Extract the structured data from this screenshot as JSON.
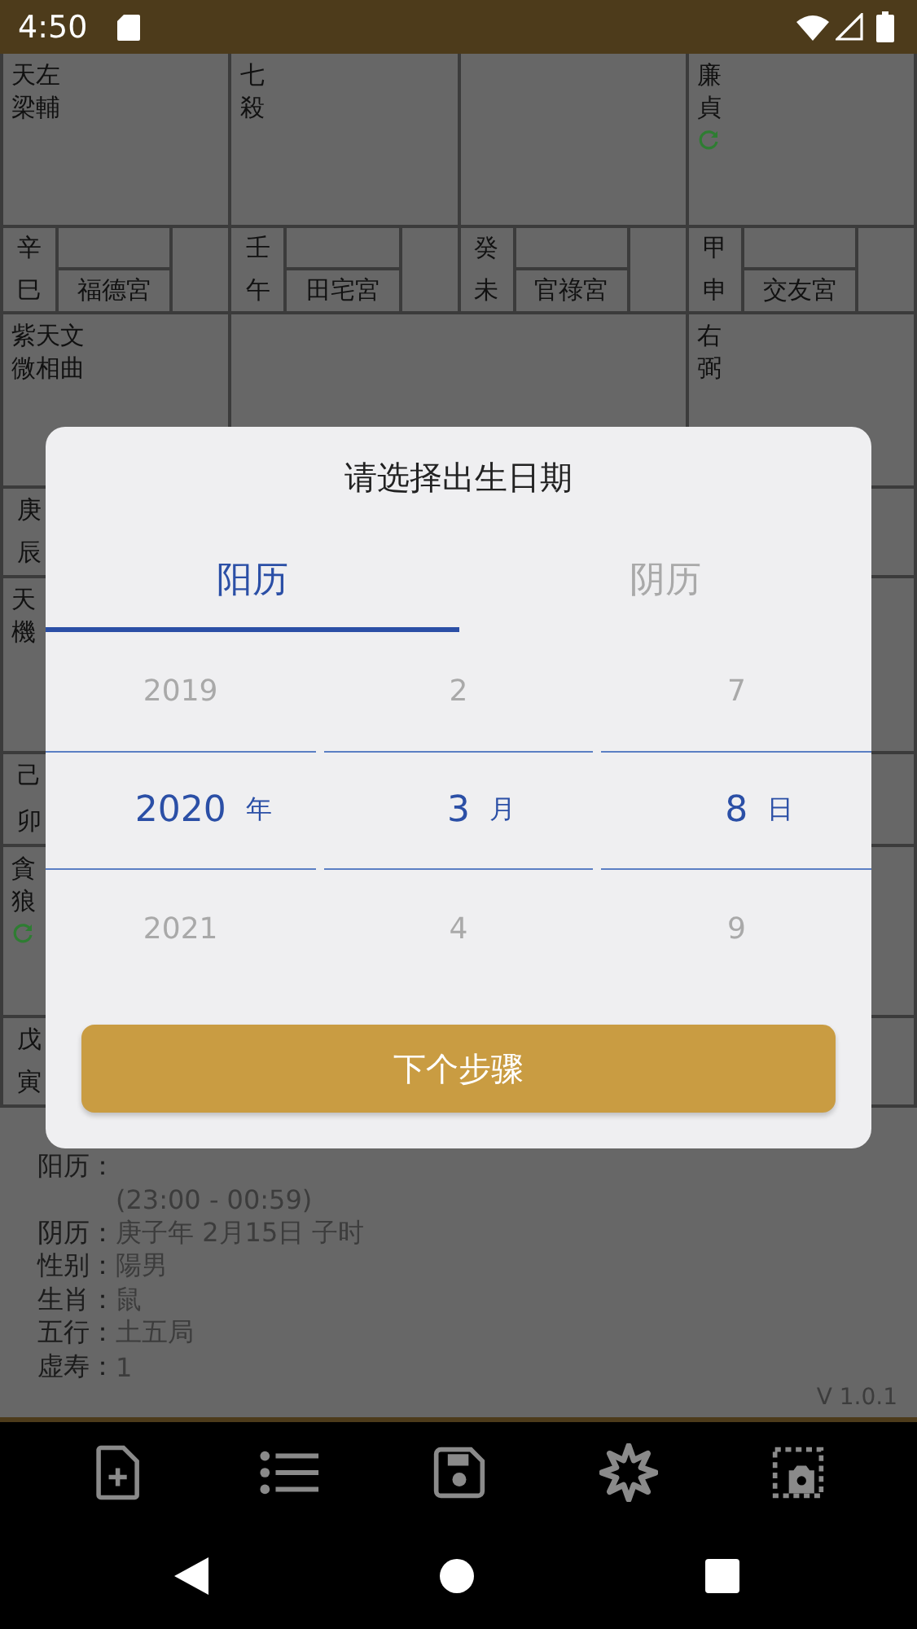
{
  "status_bar": {
    "time": "4:50"
  },
  "chart": {
    "cells": [
      {
        "kind": "stars",
        "lines": [
          "天左",
          "梁輔"
        ],
        "marked": false
      },
      {
        "kind": "stars",
        "lines": [
          "七",
          "殺"
        ],
        "marked": false
      },
      {
        "kind": "stars",
        "marked": false
      },
      {
        "kind": "stars",
        "lines": [
          "廉",
          "貞"
        ],
        "marked": true
      },
      {
        "kind": "palace",
        "stem": "辛",
        "branch": "巳",
        "name": "福德宮"
      },
      {
        "kind": "palace",
        "stem": "壬",
        "branch": "午",
        "name": "田宅宮"
      },
      {
        "kind": "palace",
        "stem": "癸",
        "branch": "未",
        "name": "官祿宮"
      },
      {
        "kind": "palace",
        "stem": "甲",
        "branch": "申",
        "name": "交友宮"
      },
      {
        "kind": "stars",
        "lines": [
          "紫天文",
          "微相曲"
        ],
        "marked": false
      },
      {
        "kind": "center"
      },
      {
        "kind": "stars",
        "lines": [
          "右",
          "弼"
        ],
        "marked": false
      },
      {
        "kind": "palace",
        "stem": "庚",
        "branch": "辰"
      },
      {
        "kind": "palace"
      },
      {
        "kind": "stars",
        "lines": [
          "天",
          "機"
        ],
        "marked": false
      },
      {
        "kind": "stars",
        "marked": false
      },
      {
        "kind": "palace",
        "stem": "己",
        "branch": "卯"
      },
      {
        "kind": "palace"
      },
      {
        "kind": "stars",
        "lines": [
          "貪",
          "狼"
        ],
        "marked": true
      },
      {
        "kind": "stars",
        "marked": false
      },
      {
        "kind": "palace",
        "stem": "戊",
        "branch": "寅"
      },
      {
        "kind": "palace"
      }
    ]
  },
  "info": {
    "rows": [
      {
        "label": "阳历："
      },
      {
        "value": "(23:00 - 00:59)"
      },
      {
        "label": "阴历：",
        "value": "庚子年 2月15日 子时"
      },
      {
        "label": "性别：",
        "value": "陽男"
      },
      {
        "label": "生肖：",
        "value": "鼠"
      },
      {
        "label": "五行：",
        "value": "土五局"
      },
      {
        "label": "虚寿：",
        "value": "1"
      }
    ],
    "version": "V 1.0.1"
  },
  "dialog": {
    "title": "请选择出生日期",
    "tabs": [
      {
        "label": "阳历",
        "selected": true
      },
      {
        "label": "阴历",
        "selected": false
      }
    ],
    "columns": [
      {
        "unit": "年",
        "items": [
          {
            "text": "2019",
            "selected": false
          },
          {
            "text": "2020",
            "selected": true
          },
          {
            "text": "2021",
            "selected": false
          }
        ]
      },
      {
        "unit": "月",
        "items": [
          {
            "text": "2",
            "selected": false
          },
          {
            "text": "3",
            "selected": true
          },
          {
            "text": "4",
            "selected": false
          }
        ]
      },
      {
        "unit": "日",
        "items": [
          {
            "text": "7",
            "selected": false
          },
          {
            "text": "8",
            "selected": true
          },
          {
            "text": "9",
            "selected": false
          }
        ]
      }
    ],
    "button": "下个步骤"
  }
}
